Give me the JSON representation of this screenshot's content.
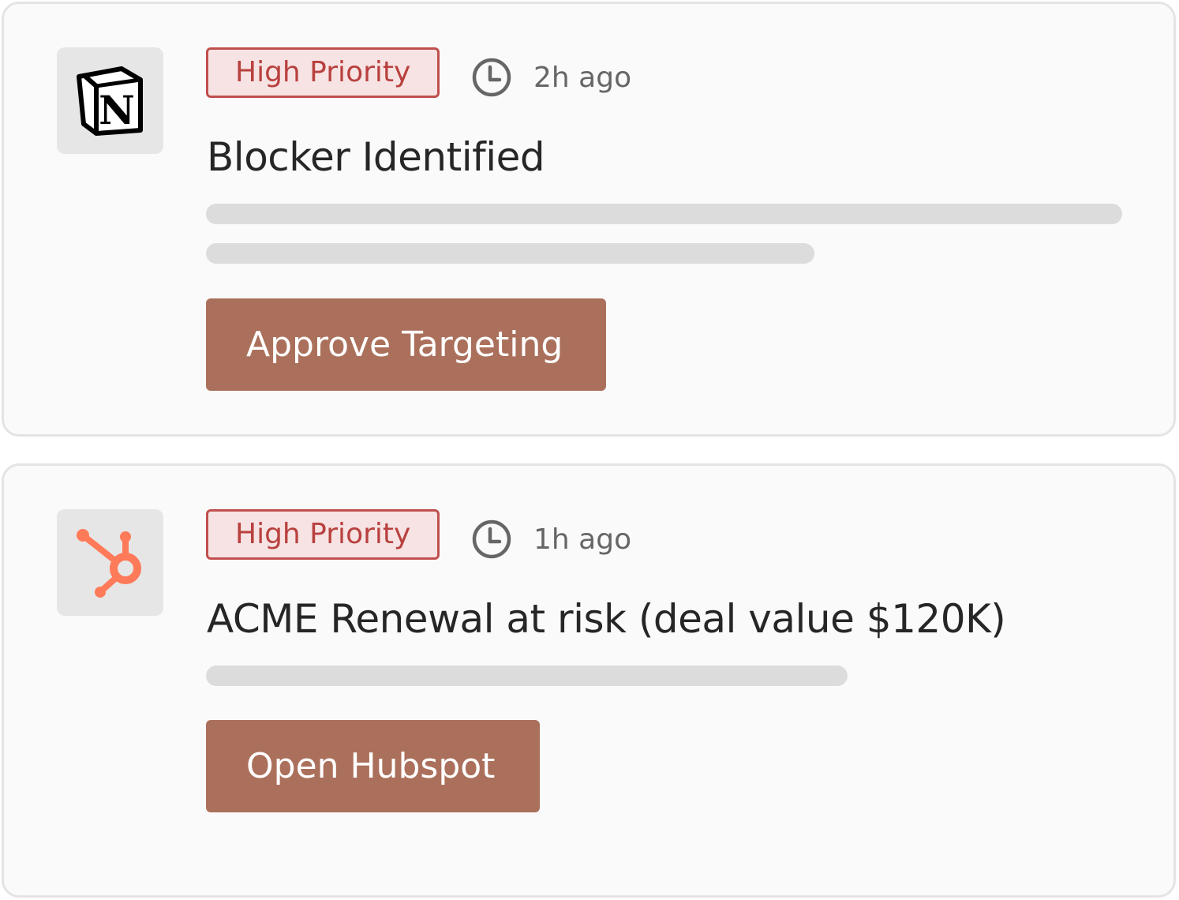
{
  "notifications": [
    {
      "app_icon": "notion-logo-icon",
      "app_logo_text": "N",
      "badge": "High Priority",
      "time": "2h ago",
      "title": "Blocker Identified",
      "action_label": "Approve Targeting"
    },
    {
      "app_icon": "hubspot-logo-icon",
      "badge": "High Priority",
      "time": "1h ago",
      "title": "ACME Renewal at risk (deal value $120K)",
      "action_label": "Open Hubspot"
    }
  ],
  "colors": {
    "card_background": "#fafafa",
    "card_border": "#e4e4e4",
    "badge_border": "#c0504e",
    "badge_background": "#f7e3e3",
    "badge_text": "#b8413f",
    "button_background": "#ab705b",
    "button_text": "#ffffff",
    "hubspot_orange": "#ff7a59",
    "skeleton": "#dcdcdc"
  },
  "icons": {
    "clock": "clock-icon"
  }
}
